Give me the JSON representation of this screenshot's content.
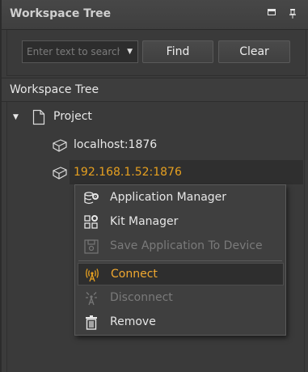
{
  "panel": {
    "title": "Workspace Tree"
  },
  "search": {
    "placeholder": "Enter text to search"
  },
  "buttons": {
    "find": "Find",
    "clear": "Clear"
  },
  "section": {
    "title": "Workspace Tree"
  },
  "tree": {
    "project": "Project",
    "local_device": "localhost:1876",
    "remote_device": "192.168.1.52:1876"
  },
  "context_menu": {
    "items": [
      {
        "label": "Application Manager",
        "icon": "application-manager-icon",
        "enabled": true
      },
      {
        "label": "Kit Manager",
        "icon": "kit-manager-icon",
        "enabled": true
      },
      {
        "label": "Save Application To Device",
        "icon": "save-device-icon",
        "enabled": false
      },
      {
        "label": "Connect",
        "icon": "connect-antenna-icon",
        "enabled": true,
        "active": true
      },
      {
        "label": "Disconnect",
        "icon": "disconnect-antenna-icon",
        "enabled": false
      },
      {
        "label": "Remove",
        "icon": "trash-icon",
        "enabled": true
      }
    ]
  },
  "colors": {
    "accent": "#E6A020",
    "background": "#3A3A3A",
    "text": "#E8E8E8",
    "disabled_text": "#7A7A7A"
  }
}
